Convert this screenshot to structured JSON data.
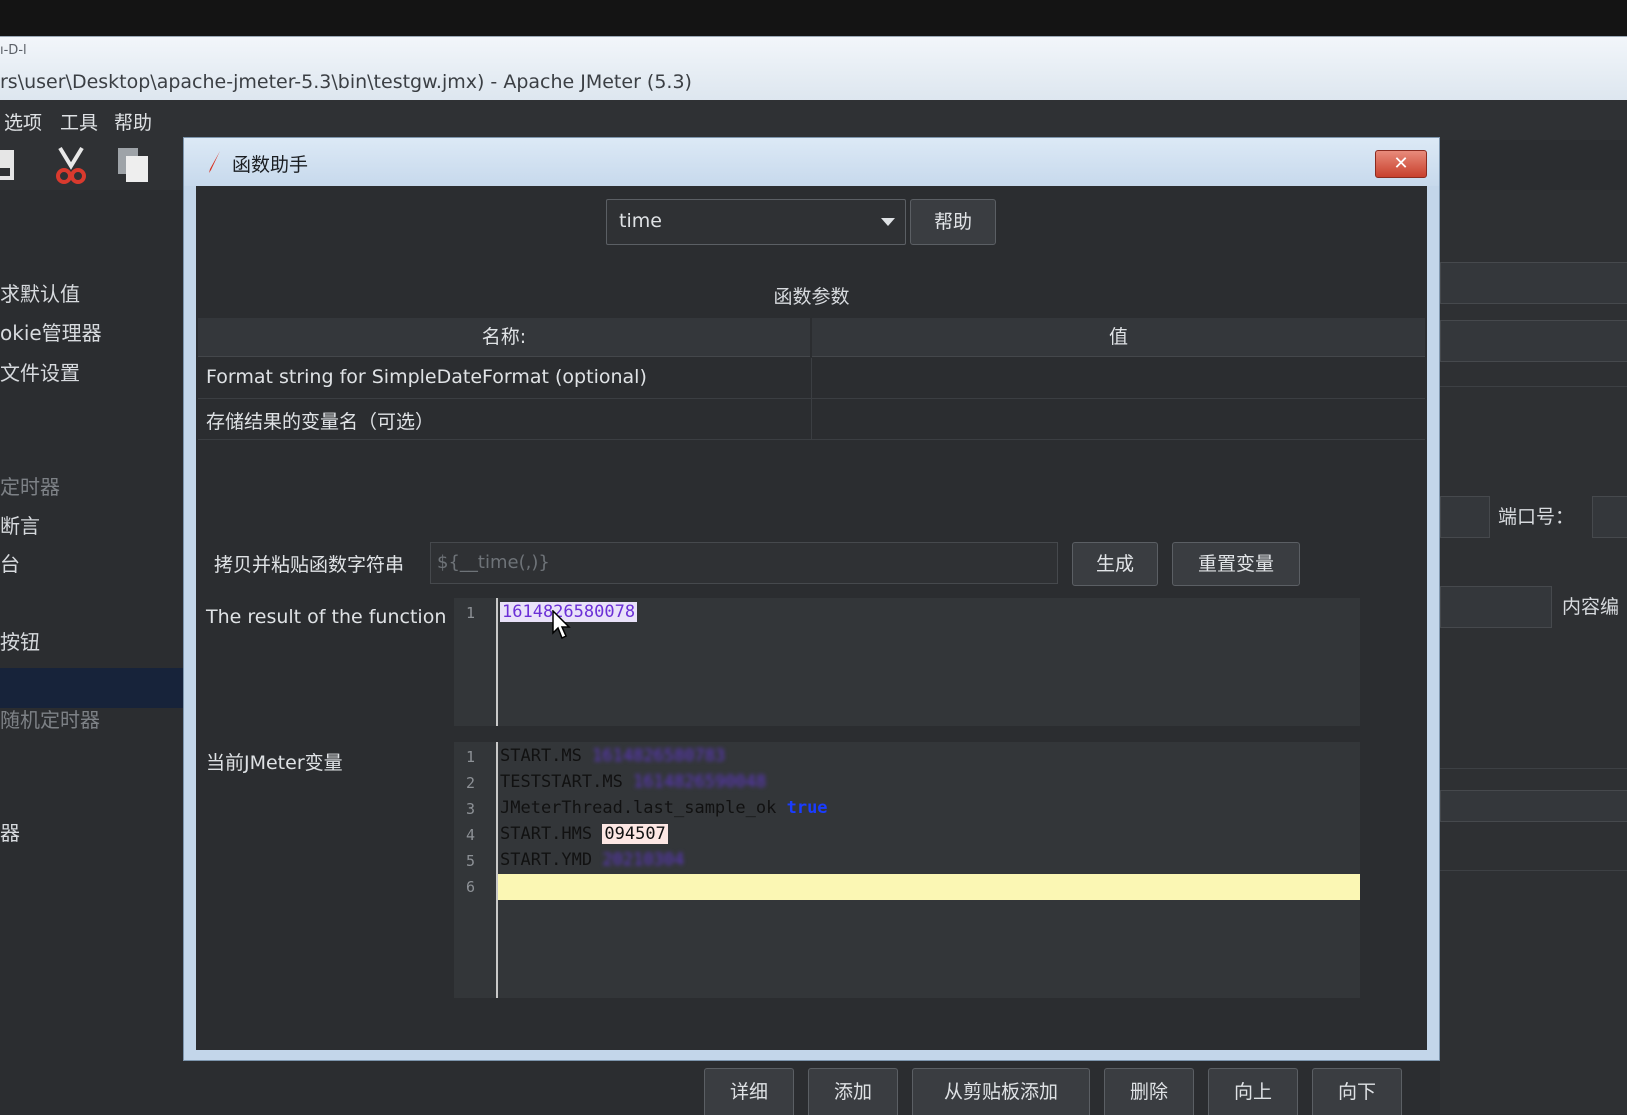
{
  "window": {
    "title": "rs\\user\\Desktop\\apache-jmeter-5.3\\bin\\testgw.jmx) - Apache JMeter (5.3)",
    "stub": "ı-D-l"
  },
  "menu": [
    "选项",
    "工具",
    "帮助"
  ],
  "tree": {
    "items": [
      {
        "label": "求默认值",
        "dim": false
      },
      {
        "label": "okie管理器",
        "dim": false
      },
      {
        "label": "文件设置",
        "dim": false
      },
      {
        "label": "定时器",
        "dim": true
      },
      {
        "label": "断言",
        "dim": false
      },
      {
        "label": "台",
        "dim": false
      },
      {
        "label": "按钮",
        "dim": false
      },
      {
        "label": "随机定时器",
        "dim": true
      },
      {
        "label": "器",
        "dim": false
      }
    ]
  },
  "right_panel": {
    "port_label": "端口号：",
    "content_label": "内容编"
  },
  "bottom_buttons": [
    "详细",
    "添加",
    "从剪贴板添加",
    "删除",
    "向上",
    "向下"
  ],
  "dialog": {
    "title": "函数助手",
    "close": "✕",
    "function_select": "time",
    "help_button": "帮助",
    "params_title": "函数参数",
    "table": {
      "headers": [
        "名称:",
        "值"
      ],
      "rows": [
        {
          "name": "Format string for SimpleDateFormat (optional)",
          "value": ""
        },
        {
          "name": "存储结果的变量名（可选）",
          "value": ""
        }
      ]
    },
    "copy_label": "拷贝并粘贴函数字符串",
    "function_string": "${__time(,)}",
    "generate_button": "生成",
    "reset_button": "重置变量",
    "result_label": "The result of the function is",
    "result_lines": [
      {
        "num": "1",
        "text": "1614826580078"
      }
    ],
    "vars_label": "当前JMeter变量",
    "var_lines": [
      {
        "num": "1",
        "key": "START.MS",
        "val": "1614826580783"
      },
      {
        "num": "2",
        "key": "TESTSTART.MS",
        "val": "1614826590048"
      },
      {
        "num": "3",
        "key": "JMeterThread.last_sample_ok",
        "val": "true"
      },
      {
        "num": "4",
        "key": "START.HMS",
        "val": "094507"
      },
      {
        "num": "5",
        "key": "START.YMD",
        "val": "20210304"
      },
      {
        "num": "6",
        "key": "",
        "val": ""
      }
    ]
  }
}
